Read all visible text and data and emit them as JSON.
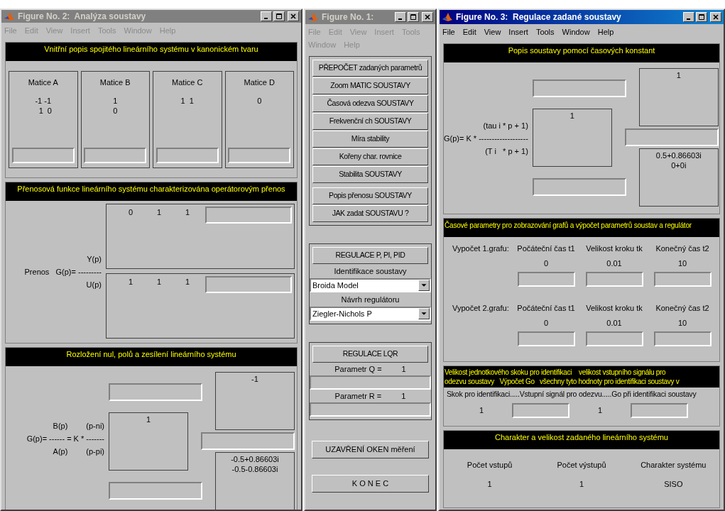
{
  "windows": [
    {
      "kind": "analysis",
      "active": false,
      "title": "Figure No. 2:  Analýza soustavy",
      "menu": [
        "File",
        "Edit",
        "View",
        "Insert",
        "Tools",
        "Window",
        "Help"
      ],
      "state_space": {
        "heading": "Vnitřní popis spojitého lineárního systému v kanonickém tvaru",
        "matrices": [
          {
            "label": "Matice A",
            "values": [
              "-1 -1",
              "  1  0"
            ]
          },
          {
            "label": "Matice B",
            "values": [
              "1",
              "0"
            ]
          },
          {
            "label": "Matice C",
            "values": [
              "1  1"
            ]
          },
          {
            "label": "Matice D",
            "values": [
              "0"
            ]
          }
        ]
      },
      "transfer": {
        "heading": "Přenosová funkce lineárního systému charakterizována operátorovým přenos",
        "formula_top": [
          "Y(p)"
        ],
        "formula_mid": [
          "Prenos   G(p)= ---------"
        ],
        "formula_bottom": [
          "U(p)"
        ],
        "numerator": [
          "0",
          "1",
          "1"
        ],
        "denominator": [
          "1",
          "1",
          "1"
        ]
      },
      "zpk": {
        "heading": "Rozložení nul, polů a zesílení lineárního systému",
        "formula_top": [
          "B(p)",
          "(p-ni)"
        ],
        "formula_mid": [
          "G(p)= ------ = K * -------"
        ],
        "formula_bottom": [
          "A(p)",
          "(p-pi)"
        ],
        "middle_values": [
          "1"
        ],
        "top_right_values": [
          "-1"
        ],
        "bottom_right_values": [
          "-0.5+0.86603i",
          "-0.5-0.86603i"
        ]
      }
    },
    {
      "kind": "control_panel",
      "active": false,
      "title": "Figure No. 1:",
      "menu": [
        "File",
        "Edit",
        "View",
        "Insert",
        "Tools",
        "Window",
        "Help"
      ],
      "groups": [
        {
          "sections": [
            [
              {
                "kind": "button",
                "label": "PŘEPOČET zadaných parametrů"
              },
              {
                "kind": "button",
                "label": "Zoom MATIC SOUSTAVY"
              },
              {
                "kind": "button",
                "label": "Časová odezva SOUSTAVY"
              },
              {
                "kind": "button",
                "label": "Frekvenční ch SOUSTAVY"
              },
              {
                "kind": "button",
                "label": "Míra stability"
              },
              {
                "kind": "button",
                "label": "Kořeny char. rovnice"
              },
              {
                "kind": "button",
                "label": "Stabilita SOUSTAVY"
              }
            ],
            [
              {
                "kind": "button",
                "label": "Popis přenosu SOUSTAVY"
              },
              {
                "kind": "button",
                "label": "JAK zadat SOUSTAVU ?"
              }
            ]
          ]
        },
        {
          "sections": [
            [
              {
                "kind": "button",
                "label": "REGULACE P, PI, PID"
              },
              {
                "kind": "label",
                "label": "Identifikace soustavy"
              },
              {
                "kind": "dropdown",
                "label": "Broida Model"
              },
              {
                "kind": "label",
                "label": "Návrh regulátoru"
              },
              {
                "kind": "dropdown",
                "label": "Ziegler-Nichols P"
              }
            ]
          ]
        },
        {
          "sections": [
            [
              {
                "kind": "button",
                "label": "REGULACE LQR"
              },
              {
                "kind": "param",
                "label": "Parametr Q =",
                "value": "1"
              },
              {
                "kind": "field"
              },
              {
                "kind": "param",
                "label": "Parametr R =",
                "value": "1"
              },
              {
                "kind": "field"
              }
            ]
          ]
        }
      ],
      "footer_buttons": [
        "UZAVŘENÍ OKEN měření",
        "K O N E C"
      ]
    },
    {
      "kind": "regulation",
      "active": true,
      "title": "Figure No. 3:  Regulace zadané soustavy",
      "menu": [
        "File",
        "Edit",
        "View",
        "Insert",
        "Tools",
        "Window",
        "Help"
      ],
      "zpk": {
        "heading": "Popis soustavy pomocí časových konstant",
        "formula_top": [
          "(tau i * p + 1)"
        ],
        "formula_mid": [
          "G(p)= K * -------------------"
        ],
        "formula_bottom": [
          "(T i   * p + 1)"
        ],
        "middle_values": [
          "1"
        ],
        "top_right_values": [
          "1"
        ],
        "bottom_right_values": [
          "0.5+0.86603i",
          "0+0i"
        ]
      },
      "time_params": {
        "heading": "Časové parametry pro zobrazování grafů a výpočet parametrů soustav a regulátor",
        "rows": [
          {
            "label": "Vypočet 1.grafu:",
            "columns": [
              {
                "header": "Počáteční čas t1",
                "value": "0"
              },
              {
                "header": "Velikost kroku tk",
                "value": "0.01"
              },
              {
                "header": "Konečný čas t2",
                "value": "10"
              }
            ]
          },
          {
            "label": "Vypočet 2.grafu:",
            "columns": [
              {
                "header": "Počáteční čas t1",
                "value": "0"
              },
              {
                "header": "Velikost kroku tk",
                "value": "0.01"
              },
              {
                "header": "Konečný čas t2",
                "value": "10"
              }
            ]
          }
        ]
      },
      "identification": {
        "heading_lines": [
          "Velikost jednotkového skoku pro identifikaci    velikost vstupního signálu pro",
          "odezvu soustavy   Výpočet Go   všechny tyto hodnoty pro identifikaci soustavy v"
        ],
        "caption": "Skok pro identifikaci.....Vstupní signál pro odezvu.....Go při identifikaci soustavy",
        "values": [
          "1",
          "1"
        ]
      },
      "system": {
        "heading": "Charakter a velikost zadaného lineárního systému",
        "columns": [
          {
            "label": "Počet vstupů",
            "value": "1"
          },
          {
            "label": "Počet výstupů",
            "value": "1"
          },
          {
            "label": "Charakter systému",
            "value": "SISO"
          }
        ]
      }
    }
  ]
}
